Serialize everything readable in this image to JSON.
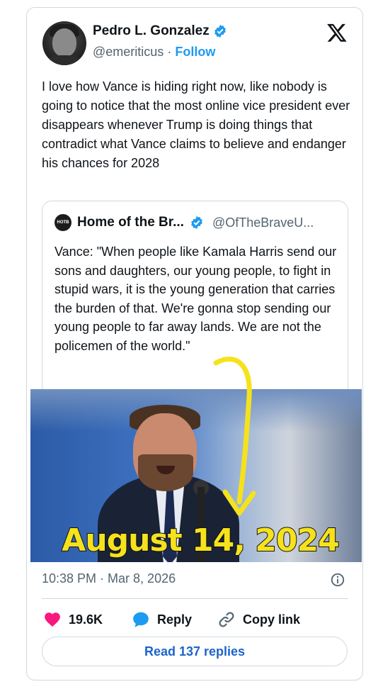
{
  "author": {
    "name": "Pedro L. Gonzalez",
    "handle": "@emeriticus",
    "separator": "·",
    "follow_label": "Follow"
  },
  "tweet": {
    "text": "I love how Vance is hiding right now, like nobody is going to notice that the most online vice president ever disappears whenever Trump is doing things that contradict what Vance claims to believe and endanger his chances for 2028"
  },
  "quote": {
    "logo_text": "HOTB",
    "name": "Home of the Br...",
    "handle": "@OfTheBraveU...",
    "text": "Vance: \"When people like Kamala Harris send our sons and daughters, our young people, to fight in stupid wars, it is the young generation that carries the burden of that. We're gonna stop sending our young people to far away lands. We are not the policemen of the world.\""
  },
  "image": {
    "overlay_text": "August 14, 2024"
  },
  "meta": {
    "timestamp": "10:38 PM · Mar 8, 2026"
  },
  "actions": {
    "like_count": "19.6K",
    "reply_label": "Reply",
    "copy_label": "Copy link"
  },
  "read_replies_label": "Read 137 replies",
  "colors": {
    "brand_blue": "#1d9bf0",
    "like_pink": "#f91880",
    "overlay_yellow": "#f6e21c"
  }
}
